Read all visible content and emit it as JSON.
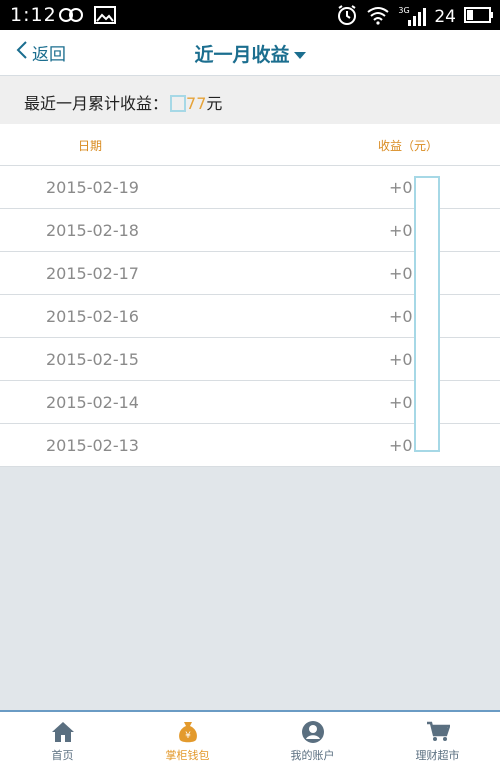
{
  "status_bar": {
    "time": "1:12",
    "signal_label": "3G",
    "battery_percent": "24",
    "icons": [
      "infinity-icon",
      "image-icon",
      "alarm-icon",
      "wifi-icon",
      "signal-icon",
      "battery-icon"
    ]
  },
  "header": {
    "back_label": "返回",
    "title": "近一月收益"
  },
  "summary": {
    "label": "最近一月累计收益：",
    "amount_visible": "77",
    "unit": "元"
  },
  "table": {
    "columns": [
      "日期",
      "收益（元）"
    ],
    "rows": [
      {
        "date": "2015-02-19",
        "income": "+0."
      },
      {
        "date": "2015-02-18",
        "income": "+0."
      },
      {
        "date": "2015-02-17",
        "income": "+0."
      },
      {
        "date": "2015-02-16",
        "income": "+0."
      },
      {
        "date": "2015-02-15",
        "income": "+0."
      },
      {
        "date": "2015-02-14",
        "income": "+0."
      },
      {
        "date": "2015-02-13",
        "income": "+0."
      }
    ]
  },
  "tabbar": {
    "items": [
      {
        "label": "首页",
        "icon": "home-icon",
        "active": false
      },
      {
        "label": "掌柜钱包",
        "icon": "money-bag-icon",
        "active": true
      },
      {
        "label": "我的账户",
        "icon": "user-icon",
        "active": false
      },
      {
        "label": "理财超市",
        "icon": "cart-icon",
        "active": false
      }
    ]
  },
  "colors": {
    "brand": "#1b6e8f",
    "accent": "#e6a33a",
    "active_tab": "#e39a2d",
    "tab_border": "#6a9bc4",
    "background": "#e1e6ea"
  }
}
